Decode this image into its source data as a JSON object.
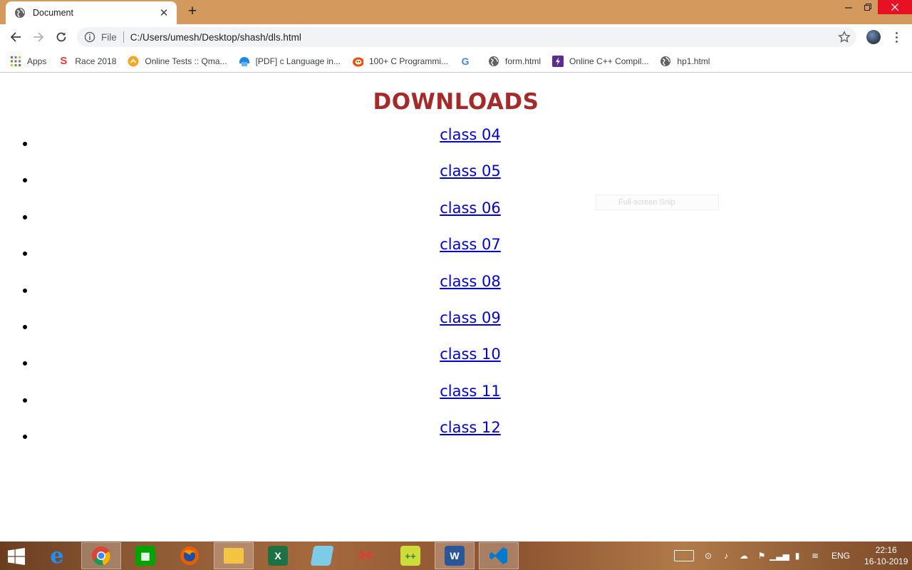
{
  "browser": {
    "tab_title": "Document",
    "scheme_label": "File",
    "url": "C:/Users/umesh/Desktop/shash/dls.html",
    "new_tab_symbol": "+",
    "close_symbol": "✕"
  },
  "bookmarks": [
    {
      "label": "Apps",
      "icon": "apps-grid-icon"
    },
    {
      "label": "Race 2018",
      "icon": "race-icon"
    },
    {
      "label": "Online Tests :: Qma...",
      "icon": "qma-icon"
    },
    {
      "label": "[PDF] c Language in...",
      "icon": "pdf-icon"
    },
    {
      "label": "100+ C Programmi...",
      "icon": "programming-icon"
    },
    {
      "label": "",
      "icon": "google-icon"
    },
    {
      "label": "form.html",
      "icon": "globe-icon"
    },
    {
      "label": "Online C++ Compil...",
      "icon": "compiler-icon"
    },
    {
      "label": "hp1.html",
      "icon": "globe-icon"
    }
  ],
  "page": {
    "heading": "DOWNLOADS",
    "links": [
      "class 04",
      "class 05",
      "class 06",
      "class 07",
      "class 08",
      "class 09",
      "class 10",
      "class 11",
      "class 12"
    ],
    "snip_label": "Full-screen Snip",
    "colors": {
      "heading": "#a52a2a",
      "link": "#0000cc"
    }
  },
  "taskbar": {
    "apps": [
      "internet-explorer-icon",
      "chrome-icon",
      "store-icon",
      "firefox-icon",
      "file-explorer-icon",
      "excel-icon",
      "notepad-icon",
      "snipping-tool-icon",
      "notepad-plus-plus-icon",
      "word-icon",
      "vscode-icon"
    ],
    "language": "ENG",
    "time": "22:16",
    "date": "16-10-2019"
  }
}
